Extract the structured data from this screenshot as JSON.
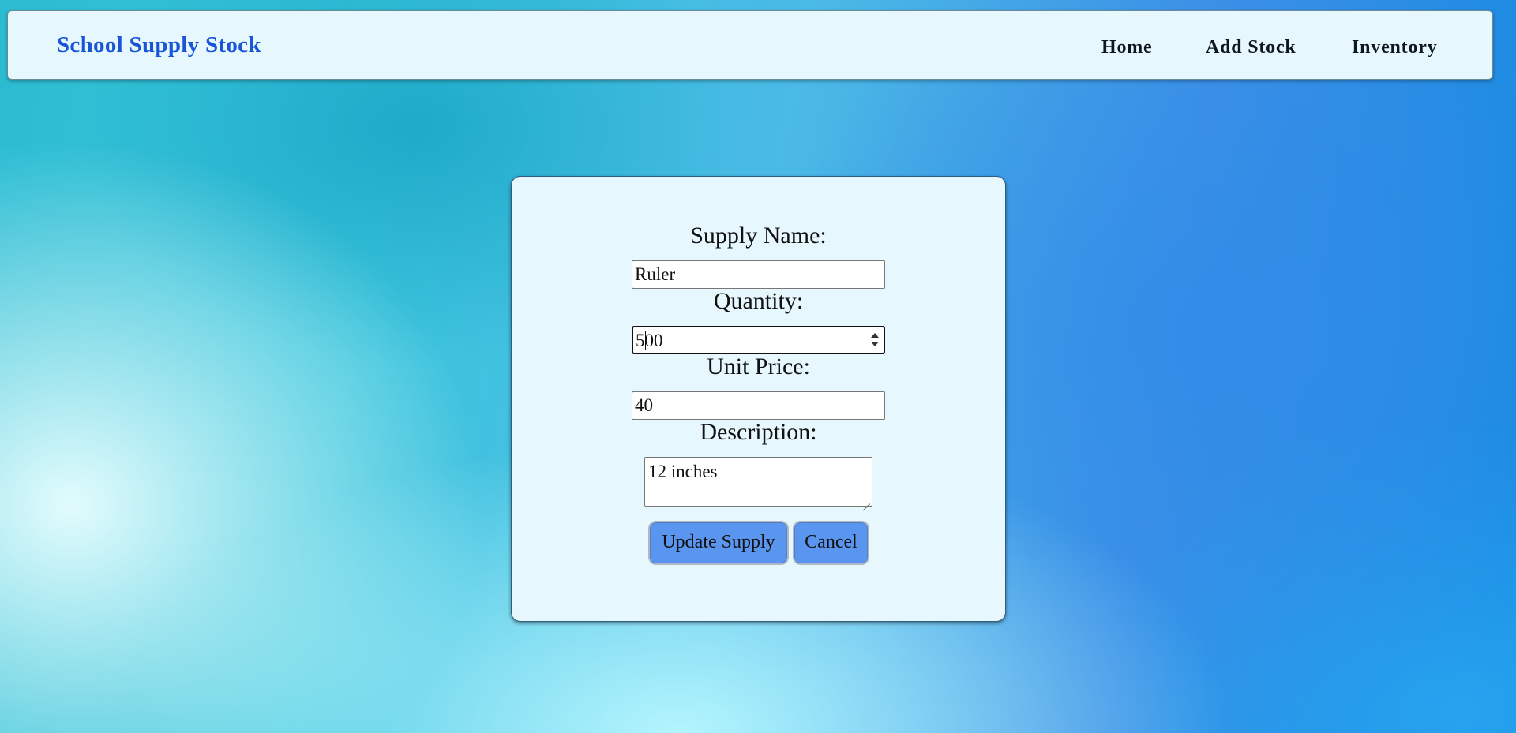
{
  "header": {
    "brand": "School Supply Stock",
    "nav": [
      "Home",
      "Add Stock",
      "Inventory"
    ]
  },
  "form": {
    "supply_name_label": "Supply Name:",
    "supply_name_value": "Ruler",
    "quantity_label": "Quantity:",
    "quantity_value_before_caret": "5",
    "quantity_value_after_caret": "00",
    "unit_price_label": "Unit Price:",
    "unit_price_value": "40",
    "description_label": "Description:",
    "description_value": "12 inches",
    "update_button": "Update Supply",
    "cancel_button": "Cancel"
  }
}
